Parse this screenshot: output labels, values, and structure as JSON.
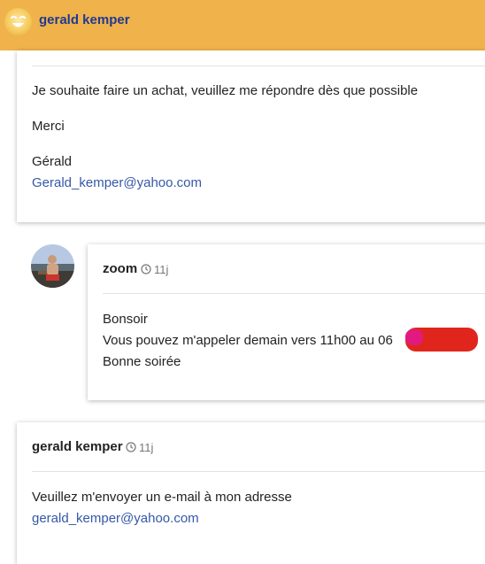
{
  "header": {
    "name": "gerald kemper"
  },
  "message1": {
    "line1": "Je souhaite faire un achat, veuillez me répondre dès que possible",
    "line2": "Merci",
    "signature_name": "Gérald",
    "signature_email": "Gerald_kemper@yahoo.com"
  },
  "message2": {
    "author": "zoom",
    "time": "11j",
    "line1": "Bonsoir",
    "line2": "Vous pouvez m'appeler demain vers 11h00 au 06",
    "line3": "Bonne soirée"
  },
  "message3": {
    "author": "gerald kemper",
    "time": "11j",
    "line1": "Veuillez m'envoyer un e-mail à mon adresse",
    "email": "gerald_kemper@yahoo.com"
  },
  "colors": {
    "header_bg": "#f0b24a",
    "header_text": "#1f3a93",
    "link": "#3558a8",
    "redaction": "#e0261c"
  },
  "icons": [
    "smiley-avatar-icon",
    "clock-icon"
  ]
}
